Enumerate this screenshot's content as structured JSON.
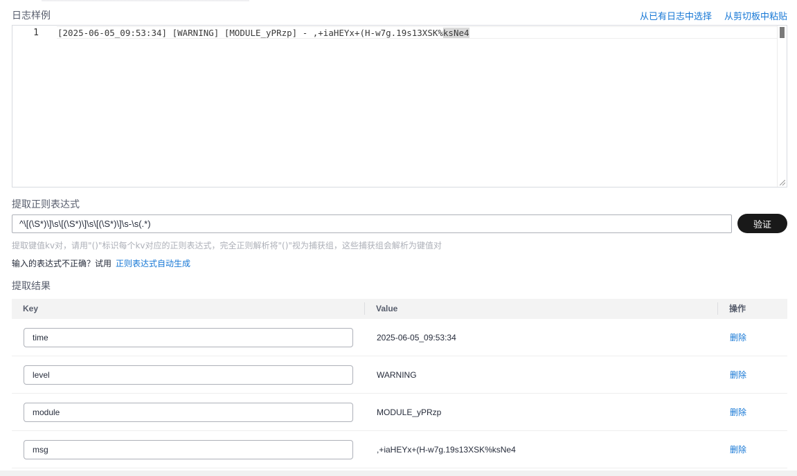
{
  "sample": {
    "title": "日志样例",
    "select_link": "从已有日志中选择",
    "paste_link": "从剪切板中粘贴",
    "line_number": "1",
    "log_text_plain": "[2025-06-05_09:53:34] [WARNING] [MODULE_yPRzp] - ,+iaHEYx+(H-w7g.19s13XSK%",
    "log_text_selected": "ksNe4"
  },
  "regex": {
    "title": "提取正则表达式",
    "value": "^\\[(\\S*)\\]\\s\\[(\\S*)\\]\\s\\[(\\S*)\\]\\s-\\s(.*)",
    "verify_button": "验证",
    "hint": "提取键值kv对，请用\"()\"标识每个kv对应的正则表达式，完全正则解析将\"()\"视为捕获组，这些捕获组会解析为键值对",
    "autogen_prefix": "输入的表达式不正确？试用",
    "autogen_link": "正则表达式自动生成"
  },
  "result": {
    "title": "提取结果",
    "columns": {
      "key": "Key",
      "value": "Value",
      "op": "操作"
    },
    "rows": [
      {
        "key": "time",
        "value": "2025-06-05_09:53:34",
        "action": "删除"
      },
      {
        "key": "level",
        "value": "WARNING",
        "action": "删除"
      },
      {
        "key": "module",
        "value": "MODULE_yPRzp",
        "action": "删除"
      },
      {
        "key": "msg",
        "value": ",+iaHEYx+(H-w7g.19s13XSK%ksNe4",
        "action": "删除"
      }
    ]
  }
}
